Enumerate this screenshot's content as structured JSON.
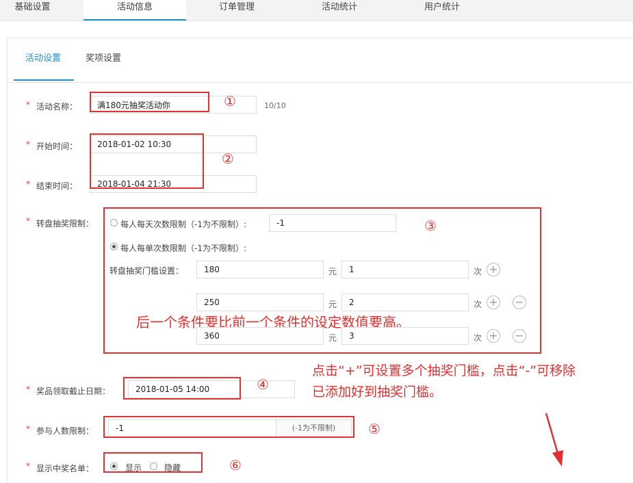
{
  "top_tabs": [
    "基础设置",
    "活动信息",
    "订单管理",
    "活动统计",
    "用户统计"
  ],
  "sub_tabs": [
    "活动设置",
    "奖项设置"
  ],
  "required_mark": "*",
  "activity_name": {
    "label": "活动名称：",
    "value": "满180元抽奖活动你",
    "counter": "10/10"
  },
  "start_time": {
    "label": "开始时间：",
    "value": "2018-01-02 10:30"
  },
  "end_time": {
    "label": "结束时间：",
    "value": "2018-01-04 21:30"
  },
  "wheel_limit": {
    "label": "转盘抽奖限制：",
    "option_daily": "每人每天次数限制（-1为不限制）:",
    "daily_value": "-1",
    "option_single": "每人每单次数限制（-1为不限制）:",
    "threshold_label": "转盘抽奖门槛设置：",
    "unit_yuan": "元",
    "unit_times": "次",
    "thresholds": [
      {
        "amount": "180",
        "times": "1"
      },
      {
        "amount": "250",
        "times": "2"
      },
      {
        "amount": "360",
        "times": "3"
      }
    ]
  },
  "prize_deadline": {
    "label": "奖品领取截止日期：",
    "value": "2018-01-05 14:00"
  },
  "participant_limit": {
    "label": "参与人数限制：",
    "value": "-1",
    "hint": "(-1为不限制)"
  },
  "winner_list": {
    "label": "显示中奖名单：",
    "show": "显示",
    "hide": "隐藏"
  },
  "annotations": {
    "n1": "①",
    "n2": "②",
    "n3": "③",
    "n4": "④",
    "n5": "⑤",
    "n6": "⑥",
    "condition_note": "后一个条件要比前一个条件的设定数值要高。",
    "plus_minus_note_1": "点击“+”可设置多个抽奖门槛，点击“-”可移除",
    "plus_minus_note_2": "已添加好到抽奖门槛。"
  },
  "colors": {
    "accent": "#1e90c9",
    "annotation_red": "#e03030"
  },
  "icons": {
    "add": "plus-circle-icon",
    "remove": "minus-circle-icon",
    "pointer": "arrow-icon"
  }
}
